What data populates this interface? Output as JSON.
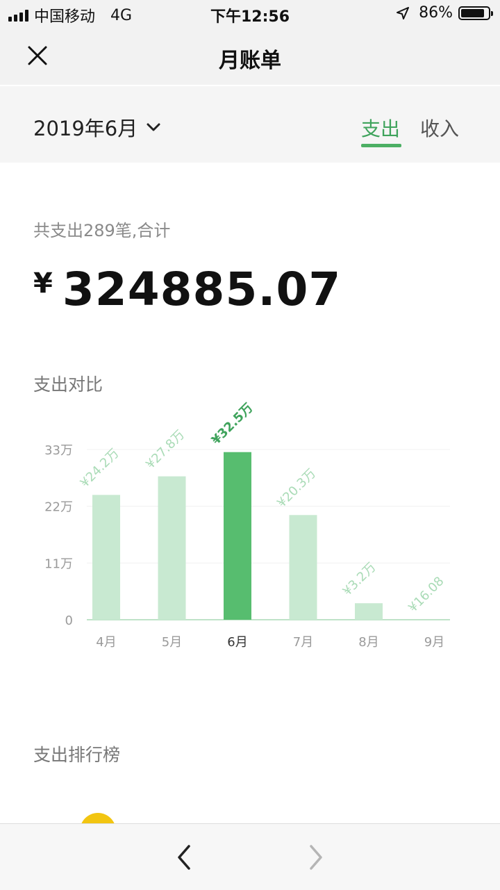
{
  "status": {
    "carrier": "中国移动",
    "network": "4G",
    "time": "下午12:56",
    "battery_text": "86%",
    "battery_level": 0.86
  },
  "nav": {
    "title": "月账单",
    "close_icon": "close-icon"
  },
  "filter": {
    "month": "2019年6月",
    "tabs": [
      {
        "label": "支出",
        "active": true
      },
      {
        "label": "收入",
        "active": false
      }
    ]
  },
  "summary": {
    "label": "共支出289笔,合计",
    "currency": "¥",
    "total": "324885.07"
  },
  "compare": {
    "title": "支出对比"
  },
  "chart_data": {
    "type": "bar",
    "categories": [
      "4月",
      "5月",
      "6月",
      "7月",
      "8月",
      "9月"
    ],
    "values": [
      242000,
      278000,
      325000,
      203000,
      32000,
      16.08
    ],
    "data_labels": [
      "¥24.2万",
      "¥27.8万",
      "¥32.5万",
      "¥20.3万",
      "¥3.2万",
      "¥16.08"
    ],
    "yticks": [
      "0",
      "11万",
      "22万",
      "33万"
    ],
    "ylim": [
      0,
      330000
    ],
    "highlight_index": 2,
    "colors": {
      "bar": "#c8e9d1",
      "highlight": "#57bd6f",
      "label": "#a9dbb6",
      "highlight_label": "#3fa35c"
    }
  },
  "ranking": {
    "title": "支出排行榜"
  },
  "colors": {
    "accent": "#4caf64"
  }
}
